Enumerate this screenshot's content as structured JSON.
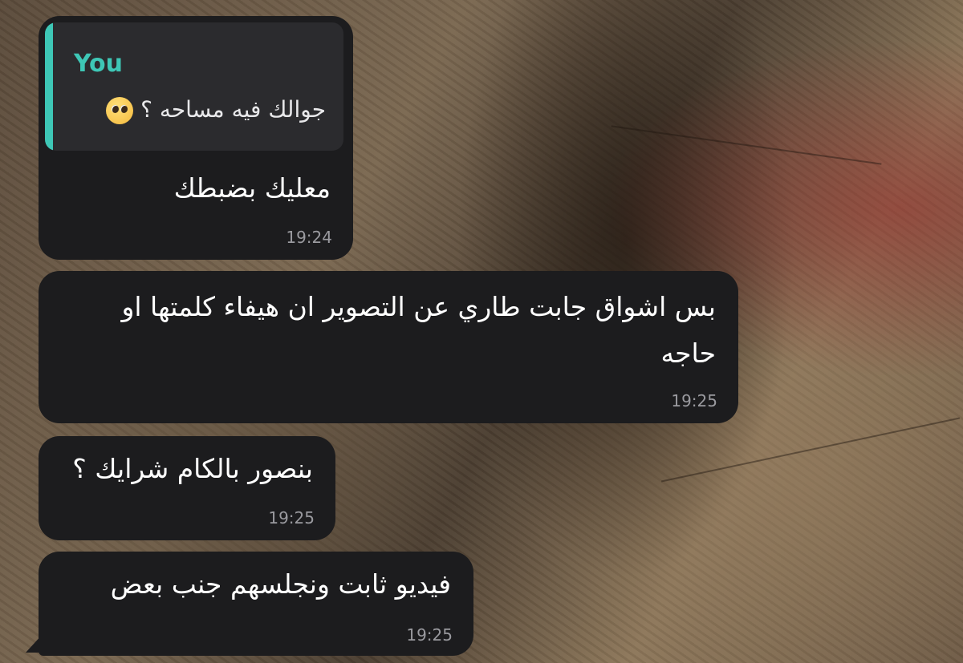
{
  "messages": [
    {
      "reply_to": {
        "author": "You",
        "text": "جوالك فيه مساحه ؟",
        "emoji": "pleading-face-icon"
      },
      "text": "معليك بضبطك",
      "time": "19:24"
    },
    {
      "text_line1": "بس اشواق جابت طاري عن التصوير ان هيفاء كلمتها او",
      "text_line2": "حاجه",
      "time": "19:25"
    },
    {
      "text": "بنصور بالكام شرايك ؟",
      "time": "19:25"
    },
    {
      "text": "فيديو ثابت ونجلسهم جنب بعض",
      "time": "19:25"
    }
  ],
  "colors": {
    "bubble": "#1c1c1e",
    "quote_accent": "#3ec7b6",
    "timestamp": "#9a9a9f"
  }
}
